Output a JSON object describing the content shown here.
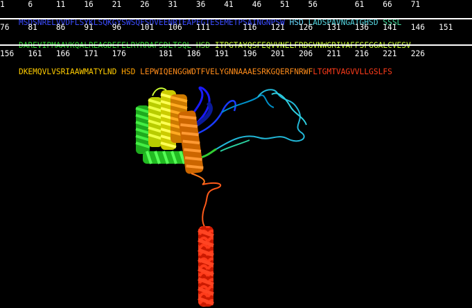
{
  "rows": [
    {
      "numbers": "1     6     11    16    21    26    31    36    41    46    51    56        61    66    71",
      "segments": [
        {
          "text": "MSDSNRELVVDFLSYKLSQKGYSWSQFSDVEENRTEAPEGTESEMETPSAINGNPSW",
          "color": "#3b4cff"
        },
        {
          "text": " HSD ",
          "color": "#66d9ff"
        },
        {
          "text": "LADSPAVNGATGHSD",
          "color": "#55d6e0"
        },
        {
          "text": " SSSL",
          "color": "#44e0a0"
        }
      ]
    },
    {
      "numbers": "76    81    86    91    96    101   106   111       116   121   126   131   136   141   146   151",
      "segments": [
        {
          "text": "DAREVIPMAAVKQALREAGDEFELRYRRAFSDLTSQL",
          "color": "#33dd33"
        },
        {
          "text": " HSD ",
          "color": "#66e033"
        },
        {
          "text": "ITPGTAYQSFEQVVNELFRDGVNWGRIVAFFSFGGALCVESV",
          "color": "#c8ff33"
        }
      ]
    },
    {
      "numbers": "156   161   166   171   176       181   186   191   196   201   206   211   216   221   226",
      "segments": [
        {
          "text": "DKEMQVLVSRIAAWMATYLND",
          "color": "#ffcc00"
        },
        {
          "text": " HSD ",
          "color": "#ffa200"
        },
        {
          "text": "LEPWIQENGGWDTFVELYGNNAAAESRKGQERFNRWF",
          "color": "#ff8c1a"
        },
        {
          "text": "LTGMTVAGVVLLGSLFS",
          "color": "#ff3b1a"
        }
      ]
    }
  ],
  "structure": {
    "colors": [
      "#1a1aff",
      "#00b4d8",
      "#2ad0a0",
      "#33cc33",
      "#99ff33",
      "#ffff33",
      "#ffa500",
      "#ff6600",
      "#ff2200"
    ]
  }
}
